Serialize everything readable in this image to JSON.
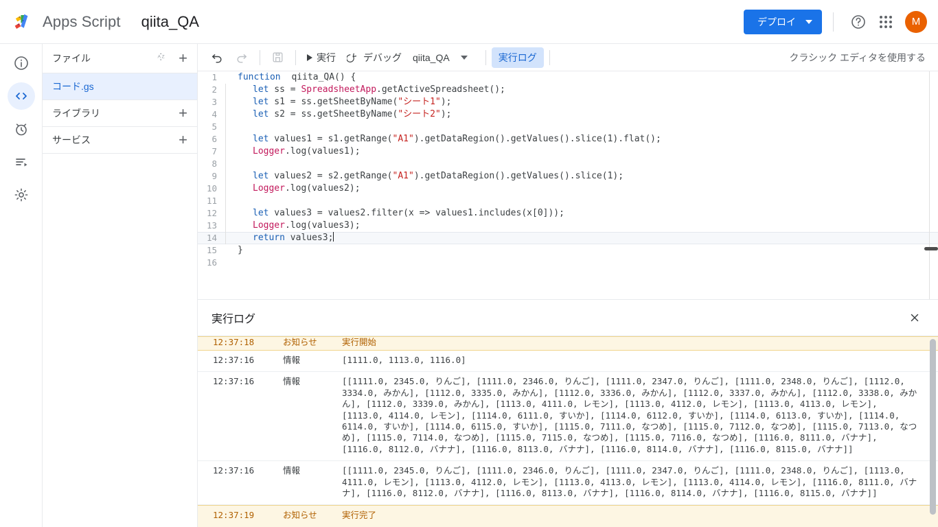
{
  "header": {
    "app_name": "Apps Script",
    "project_name": "qiita_QA",
    "deploy_label": "デプロイ",
    "help_icon": "help-circle-icon",
    "apps_icon": "apps-grid-icon",
    "avatar_letter": "M",
    "avatar_color": "#ea6100",
    "accent_color": "#1a73e8"
  },
  "rail": {
    "items": [
      {
        "name": "overview",
        "icon": "info-circle-icon",
        "active": false
      },
      {
        "name": "editor",
        "icon": "code-brackets-icon",
        "active": true
      },
      {
        "name": "triggers",
        "icon": "alarm-clock-icon",
        "active": false
      },
      {
        "name": "executions",
        "icon": "execution-list-icon",
        "active": false
      },
      {
        "name": "settings",
        "icon": "gear-icon",
        "active": false
      }
    ]
  },
  "files_panel": {
    "files_label": "ファイル",
    "sort_icon": "sort-az-icon",
    "add_icon": "plus-icon",
    "files": [
      {
        "label": "コード.gs",
        "selected": true
      }
    ],
    "libraries_label": "ライブラリ",
    "services_label": "サービス"
  },
  "toolbar": {
    "undo_icon": "undo-icon",
    "redo_icon": "redo-icon",
    "save_icon": "save-disk-icon",
    "run_label": "実行",
    "run_icon": "play-icon",
    "debug_label": "デバッグ",
    "debug_icon": "debug-step-icon",
    "function_selected": "qiita_QA",
    "dropdown_icon": "chevron-down-icon",
    "exec_log_label": "実行ログ",
    "classic_editor_label": "クラシック エディタを使用する"
  },
  "editor": {
    "lines": [
      {
        "n": "1",
        "indent": 0,
        "tokens": [
          {
            "t": "kw",
            "v": "function"
          },
          {
            "t": "sp",
            "v": " "
          },
          {
            "t": "fn",
            "v": "qiita_QA"
          },
          {
            "t": "p",
            "v": "() {"
          }
        ]
      },
      {
        "n": "2",
        "indent": 1,
        "tokens": [
          {
            "t": "kw",
            "v": "let"
          },
          {
            "t": "p",
            "v": " ss = "
          },
          {
            "t": "cls",
            "v": "SpreadsheetApp"
          },
          {
            "t": "p",
            "v": ".getActiveSpreadsheet();"
          }
        ]
      },
      {
        "n": "3",
        "indent": 1,
        "tokens": [
          {
            "t": "kw",
            "v": "let"
          },
          {
            "t": "p",
            "v": " s1 = ss.getSheetByName("
          },
          {
            "t": "str",
            "v": "\"シート1\""
          },
          {
            "t": "p",
            "v": ");"
          }
        ]
      },
      {
        "n": "4",
        "indent": 1,
        "tokens": [
          {
            "t": "kw",
            "v": "let"
          },
          {
            "t": "p",
            "v": " s2 = ss.getSheetByName("
          },
          {
            "t": "str",
            "v": "\"シート2\""
          },
          {
            "t": "p",
            "v": ");"
          }
        ]
      },
      {
        "n": "5",
        "indent": 1,
        "tokens": []
      },
      {
        "n": "6",
        "indent": 1,
        "tokens": [
          {
            "t": "kw",
            "v": "let"
          },
          {
            "t": "p",
            "v": " values1 = s1.getRange("
          },
          {
            "t": "str",
            "v": "\"A1\""
          },
          {
            "t": "p",
            "v": ").getDataRegion().getValues().slice(1).flat();"
          }
        ]
      },
      {
        "n": "7",
        "indent": 1,
        "tokens": [
          {
            "t": "cls",
            "v": "Logger"
          },
          {
            "t": "p",
            "v": ".log(values1);"
          }
        ]
      },
      {
        "n": "8",
        "indent": 1,
        "tokens": []
      },
      {
        "n": "9",
        "indent": 1,
        "tokens": [
          {
            "t": "kw",
            "v": "let"
          },
          {
            "t": "p",
            "v": " values2 = s2.getRange("
          },
          {
            "t": "str",
            "v": "\"A1\""
          },
          {
            "t": "p",
            "v": ").getDataRegion().getValues().slice(1);"
          }
        ]
      },
      {
        "n": "10",
        "indent": 1,
        "tokens": [
          {
            "t": "cls",
            "v": "Logger"
          },
          {
            "t": "p",
            "v": ".log(values2);"
          }
        ]
      },
      {
        "n": "11",
        "indent": 1,
        "tokens": []
      },
      {
        "n": "12",
        "indent": 1,
        "tokens": [
          {
            "t": "kw",
            "v": "let"
          },
          {
            "t": "p",
            "v": " values3 = values2.filter(x => values1.includes(x[0]));"
          }
        ]
      },
      {
        "n": "13",
        "indent": 1,
        "tokens": [
          {
            "t": "cls",
            "v": "Logger"
          },
          {
            "t": "p",
            "v": ".log(values3);"
          }
        ]
      },
      {
        "n": "14",
        "indent": 1,
        "active": true,
        "caret": true,
        "tokens": [
          {
            "t": "kw",
            "v": "return"
          },
          {
            "t": "p",
            "v": " values3;"
          }
        ]
      },
      {
        "n": "15",
        "indent": 0,
        "tokens": [
          {
            "t": "p",
            "v": "}"
          }
        ]
      },
      {
        "n": "16",
        "indent": 0,
        "tokens": []
      }
    ]
  },
  "log_panel": {
    "title": "実行ログ",
    "close_icon": "close-icon",
    "rows": [
      {
        "time": "12:37:18",
        "level": "お知らせ",
        "message": "実行開始",
        "type": "notice",
        "clipped": true
      },
      {
        "time": "12:37:16",
        "level": "情報",
        "message": "[1111.0, 1113.0, 1116.0]",
        "type": "info"
      },
      {
        "time": "12:37:16",
        "level": "情報",
        "message": "[[1111.0, 2345.0, りんご], [1111.0, 2346.0, りんご], [1111.0, 2347.0, りんご], [1111.0, 2348.0, りんご], [1112.0, 3334.0, みかん], [1112.0, 3335.0, みかん], [1112.0, 3336.0, みかん], [1112.0, 3337.0, みかん], [1112.0, 3338.0, みかん], [1112.0, 3339.0, みかん], [1113.0, 4111.0, レモン], [1113.0, 4112.0, レモン], [1113.0, 4113.0, レモン], [1113.0, 4114.0, レモン], [1114.0, 6111.0, すいか], [1114.0, 6112.0, すいか], [1114.0, 6113.0, すいか], [1114.0, 6114.0, すいか], [1114.0, 6115.0, すいか], [1115.0, 7111.0, なつめ], [1115.0, 7112.0, なつめ], [1115.0, 7113.0, なつめ], [1115.0, 7114.0, なつめ], [1115.0, 7115.0, なつめ], [1115.0, 7116.0, なつめ], [1116.0, 8111.0, バナナ], [1116.0, 8112.0, バナナ], [1116.0, 8113.0, バナナ], [1116.0, 8114.0, バナナ], [1116.0, 8115.0, バナナ]]",
        "type": "info"
      },
      {
        "time": "12:37:16",
        "level": "情報",
        "message": "[[1111.0, 2345.0, りんご], [1111.0, 2346.0, りんご], [1111.0, 2347.0, りんご], [1111.0, 2348.0, りんご], [1113.0, 4111.0, レモン], [1113.0, 4112.0, レモン], [1113.0, 4113.0, レモン], [1113.0, 4114.0, レモン], [1116.0, 8111.0, バナナ], [1116.0, 8112.0, バナナ], [1116.0, 8113.0, バナナ], [1116.0, 8114.0, バナナ], [1116.0, 8115.0, バナナ]]",
        "type": "info"
      },
      {
        "time": "12:37:19",
        "level": "お知らせ",
        "message": "実行完了",
        "type": "notice"
      }
    ]
  }
}
